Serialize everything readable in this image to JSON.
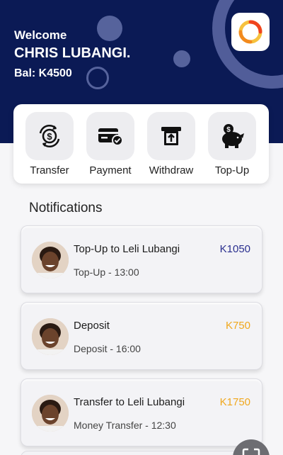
{
  "header": {
    "welcome": "Welcome",
    "username": "CHRIS LUBANGI.",
    "balance": "Bal: K4500"
  },
  "quick_actions": [
    {
      "label": "Transfer",
      "icon": "transfer-dollar-icon"
    },
    {
      "label": "Payment",
      "icon": "card-check-icon"
    },
    {
      "label": "Withdraw",
      "icon": "atm-withdraw-icon"
    },
    {
      "label": "Top-Up",
      "icon": "piggy-bank-icon"
    }
  ],
  "notifications": {
    "title": "Notifications",
    "items": [
      {
        "title": "Top-Up to Leli Lubangi",
        "subtitle": "Top-Up - 13:00",
        "amount": "K1050",
        "amount_color": "#2a2f8f"
      },
      {
        "title": "Deposit",
        "subtitle": "Deposit - 16:00",
        "amount": "K750",
        "amount_color": "#f0a81e"
      },
      {
        "title": "Transfer to Leli Lubangi",
        "subtitle": "Money Transfer - 12:30",
        "amount": "K1750",
        "amount_color": "#f0a81e"
      }
    ]
  },
  "colors": {
    "header_bg": "#0b1a55",
    "logo_orange": "#f28a1e"
  }
}
